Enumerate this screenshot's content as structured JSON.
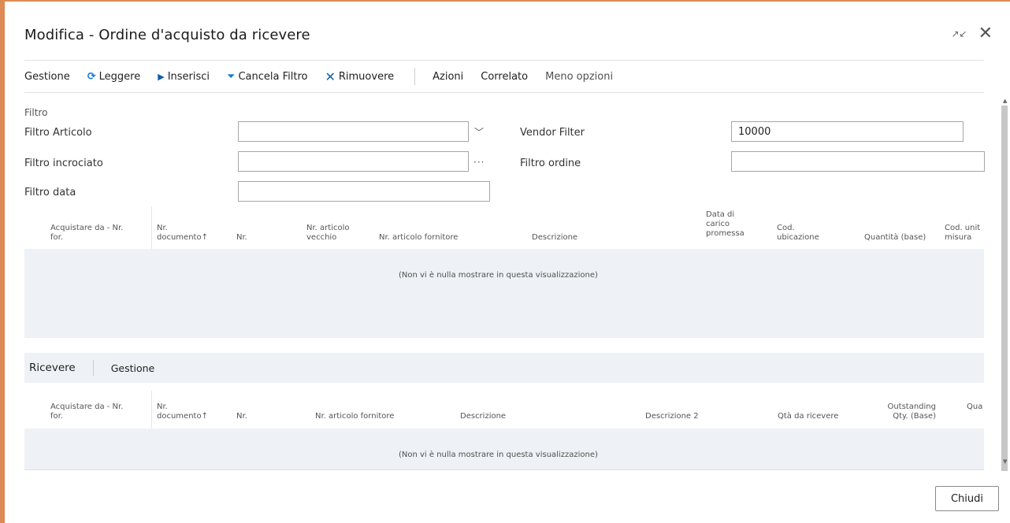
{
  "dialog": {
    "title": "Modifica - Ordine d'acquisto da ricevere",
    "restore_icon": "collapse-arrows-icon",
    "close_icon": "close-icon"
  },
  "toolbar": {
    "gestione": "Gestione",
    "leggere": "Leggere",
    "inserisci": "Inserisci",
    "cancela_filtro": "Cancela Filtro",
    "rimuovere": "Rimuovere",
    "azioni": "Azioni",
    "correlato": "Correlato",
    "meno_opzioni": "Meno opzioni"
  },
  "filters": {
    "section_title": "Filtro",
    "filtro_articolo": {
      "label": "Filtro Articolo",
      "value": ""
    },
    "filtro_incrociato": {
      "label": "Filtro incrociato",
      "value": ""
    },
    "filtro_data": {
      "label": "Filtro data",
      "value": ""
    },
    "vendor_filter": {
      "label": "Vendor Filter",
      "value": "10000"
    },
    "filtro_ordine": {
      "label": "Filtro ordine",
      "value": ""
    }
  },
  "upper_grid": {
    "columns": [
      "Acquistare da - Nr. for.",
      "Nr. documento↑",
      "Nr.",
      "Nr. articolo vecchio",
      "Nr. articolo fornitore",
      "Descrizione",
      "Data di carico promessa",
      "Cod. ubicazione",
      "Quantità (base)",
      "Cod. unit misura"
    ],
    "empty_message": "(Non vi è nulla mostrare in questa visualizzazione)"
  },
  "lower_section": {
    "tab_ricevere": "Ricevere",
    "tab_gestione": "Gestione",
    "columns": [
      "Acquistare da - Nr. for.",
      "Nr. documento↑",
      "Nr.",
      "Nr. articolo fornitore",
      "Descrizione",
      "Descrizione 2",
      "Qtà da ricevere",
      "Outstanding Qty. (Base)",
      "Qua"
    ],
    "empty_message": "(Non vi è nulla mostrare in questa visualizzazione)"
  },
  "footer": {
    "close_button": "Chiudi"
  }
}
